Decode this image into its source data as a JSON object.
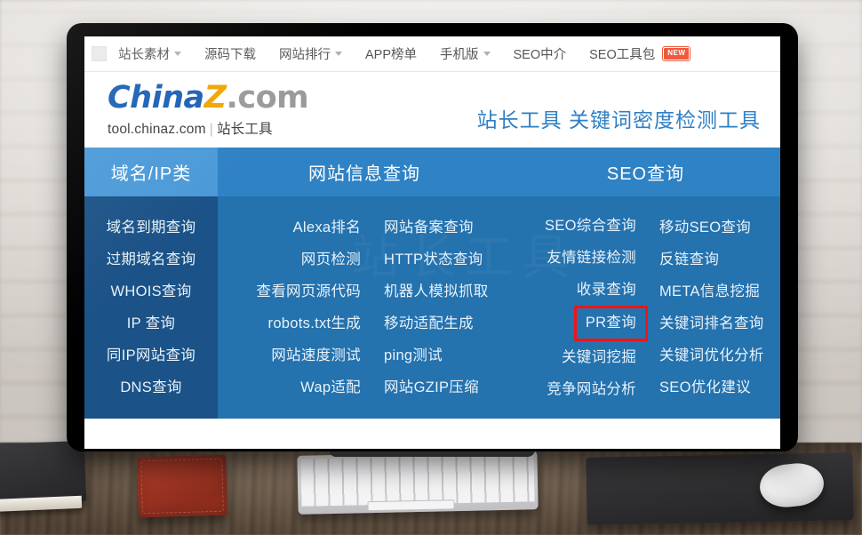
{
  "topnav": {
    "square_icon": "placeholder-square-icon",
    "items": [
      {
        "label": "站长素材",
        "caret": true
      },
      {
        "label": "源码下载",
        "caret": false
      },
      {
        "label": "网站排行",
        "caret": true
      },
      {
        "label": "APP榜单",
        "caret": false
      },
      {
        "label": "手机版",
        "caret": true
      },
      {
        "label": "SEO中介",
        "caret": false
      },
      {
        "label": "SEO工具包",
        "caret": false,
        "badge": "NEW"
      }
    ]
  },
  "brand": {
    "logo_part1": "China",
    "logo_part2": "Z",
    "logo_part3": ".com",
    "subtitle_left": "tool.chinaz.com",
    "subtitle_sep": "|",
    "subtitle_right": "站长工具",
    "page_title": "站长工具 关键词密度检测工具"
  },
  "panel": {
    "watermark": "站长工具",
    "headers": [
      {
        "label": "域名/IP类",
        "active": true
      },
      {
        "label": "网站信息查询",
        "active": false
      },
      {
        "label": "SEO查询",
        "active": false
      }
    ],
    "columns": [
      {
        "name": "domain-ip",
        "items": [
          "域名到期查询",
          "过期域名查询",
          "WHOIS查询",
          "IP 查询",
          "同IP网站查询",
          "DNS查询"
        ]
      },
      {
        "name": "site-info-left",
        "items": [
          "Alexa排名",
          "网页检测",
          "查看网页源代码",
          "robots.txt生成",
          "网站速度测试",
          "Wap适配"
        ]
      },
      {
        "name": "site-info-right",
        "items": [
          "网站备案查询",
          "HTTP状态查询",
          "机器人模拟抓取",
          "移动适配生成",
          "ping测试",
          "网站GZIP压缩"
        ]
      },
      {
        "name": "seo-left",
        "items": [
          "SEO综合查询",
          "友情链接检测",
          "收录查询",
          "PR查询",
          "关键词挖掘",
          "竞争网站分析"
        ],
        "highlighted": "PR查询"
      },
      {
        "name": "seo-right",
        "items": [
          "移动SEO查询",
          "反链查询",
          "META信息挖掘",
          "关键词排名查询",
          "关键词优化分析",
          "SEO优化建议"
        ]
      }
    ]
  },
  "colors": {
    "header_active": "#4b9ad8",
    "header_normal": "#2f82c4",
    "col_left_bg": "#1b5287",
    "col_body_bg": "#2472ae",
    "title_blue": "#2e7fc4",
    "logo_blue": "#1a5fb4",
    "logo_yellow": "#f0a500",
    "logo_gray": "#9a9a9a",
    "highlight_red": "#f01414",
    "badge_red": "#ef5a3d"
  },
  "desk": {
    "objects": [
      "book",
      "red-wallet",
      "keyboard",
      "mousepad",
      "mouse"
    ]
  }
}
